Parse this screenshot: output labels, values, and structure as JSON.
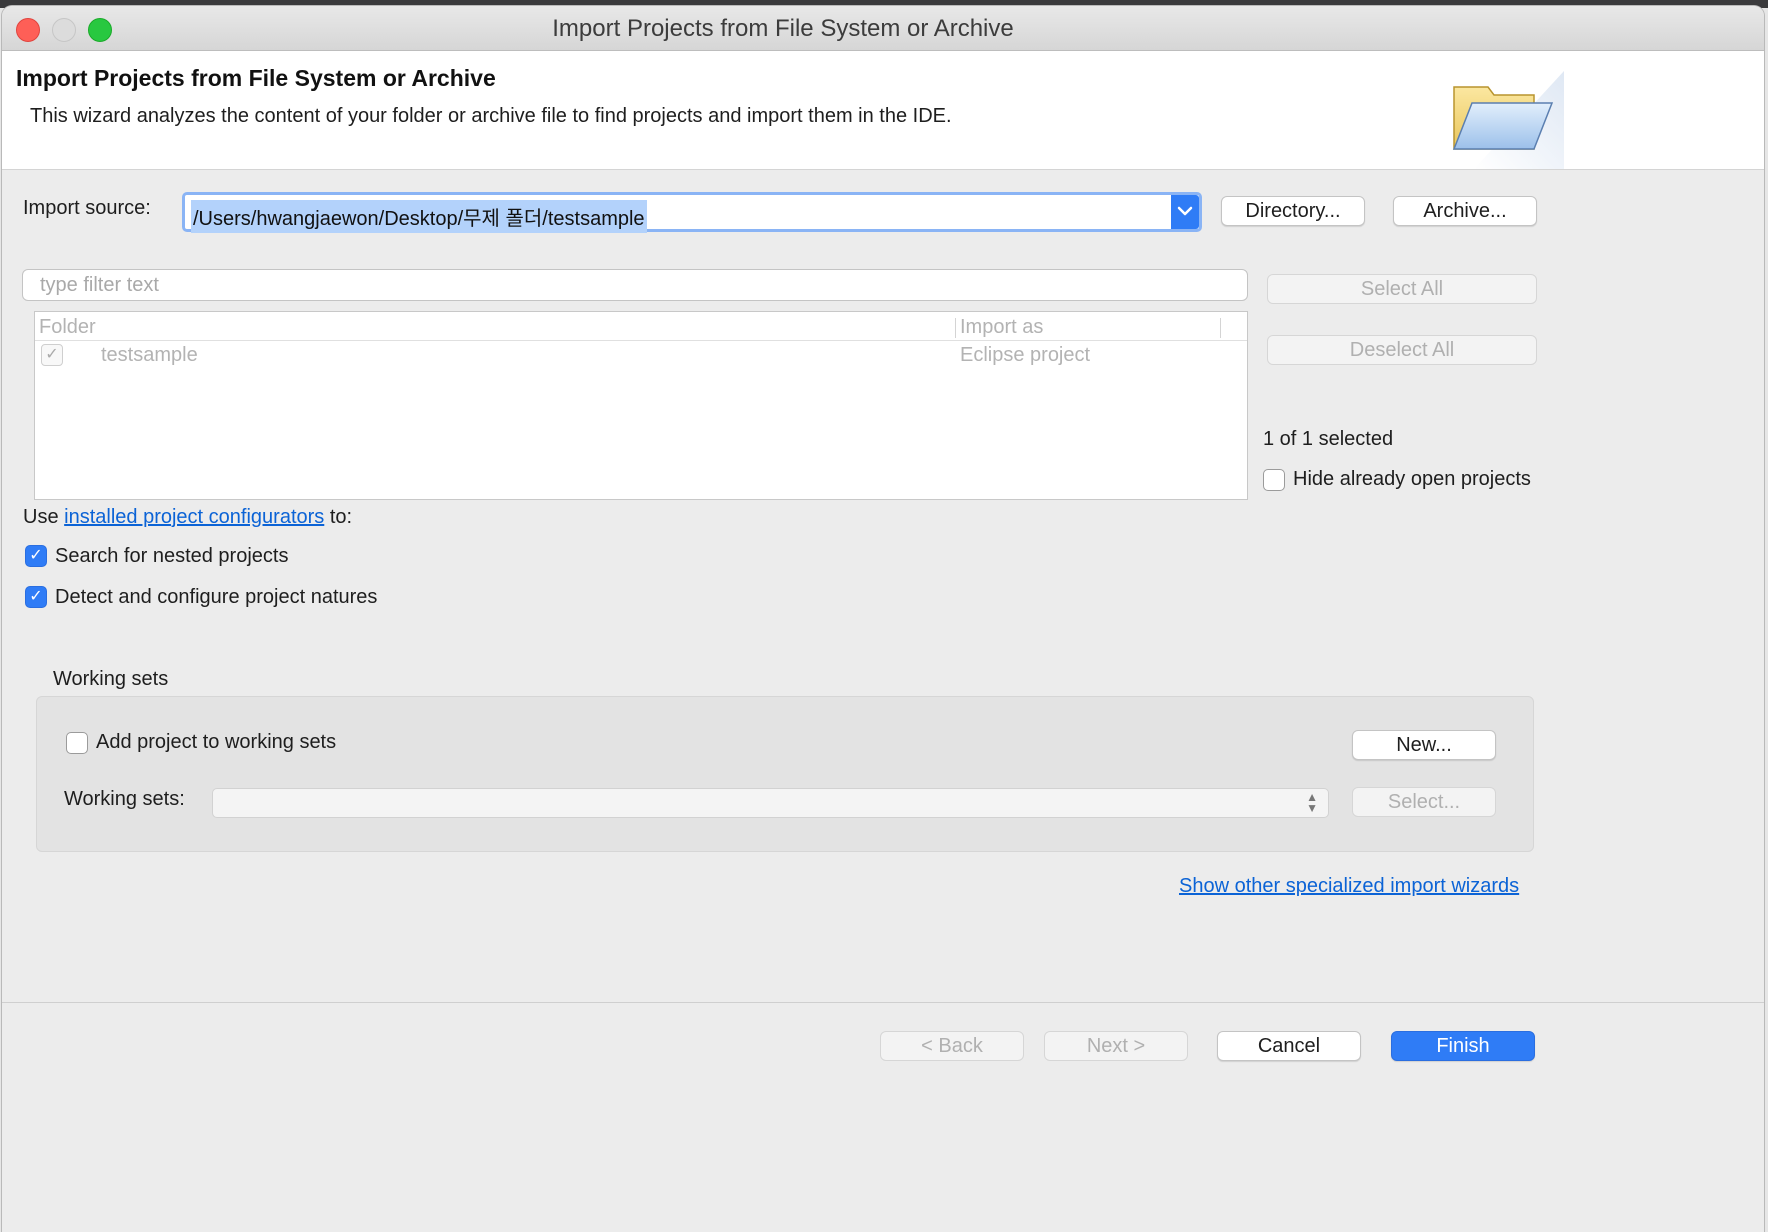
{
  "window": {
    "title": "Import Projects from File System or Archive"
  },
  "header": {
    "title": "Import Projects from File System or Archive",
    "description": "This wizard analyzes the content of your folder or archive file to find projects and import them in the IDE.",
    "icon": "folder-icon"
  },
  "import_source": {
    "label": "Import source:",
    "value": "/Users/hwangjaewon/Desktop/무제 폴더/testsample",
    "directory_button": "Directory...",
    "archive_button": "Archive..."
  },
  "filter": {
    "placeholder": "type filter text"
  },
  "table": {
    "columns": [
      "Folder",
      "Import as"
    ],
    "rows": [
      {
        "checked": true,
        "folder": "testsample",
        "import_as": "Eclipse project"
      }
    ]
  },
  "side": {
    "select_all": "Select All",
    "deselect_all": "Deselect All",
    "selection_status": "1 of 1 selected",
    "hide_open_label": "Hide already open projects",
    "hide_open_checked": false
  },
  "configurators": {
    "prefix": "Use",
    "link": "installed project configurators",
    "suffix": "to:"
  },
  "options": [
    {
      "label": "Search for nested projects",
      "checked": true
    },
    {
      "label": "Detect and configure project natures",
      "checked": true
    }
  ],
  "working_sets": {
    "group_label": "Working sets",
    "add_label": "Add project to working sets",
    "add_checked": false,
    "new_button": "New...",
    "field_label": "Working sets:",
    "select_button": "Select..."
  },
  "other_wizards_link": "Show other specialized import wizards",
  "footer": {
    "back": "< Back",
    "next": "Next >",
    "cancel": "Cancel",
    "finish": "Finish"
  },
  "colors": {
    "accent": "#2f7cf6",
    "link": "#0b63d6",
    "close": "#fe5f57",
    "zoom": "#28c840"
  }
}
